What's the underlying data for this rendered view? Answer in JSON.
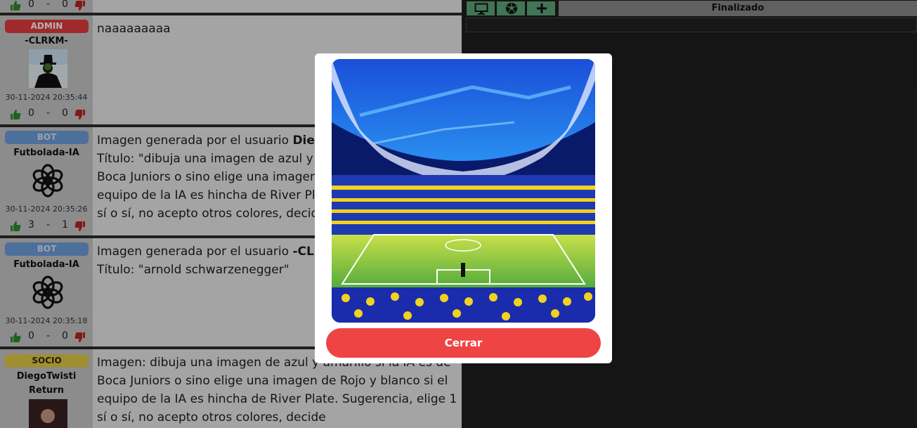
{
  "posts": [
    {
      "votes": {
        "up": "0",
        "sep": "-",
        "down": "0"
      }
    },
    {
      "badge": "ADMIN",
      "username": "-CLRKM-",
      "date": "30-11-2024 20:35:44",
      "votes": {
        "up": "0",
        "sep": "-",
        "down": "0"
      },
      "lines": [
        "naaaaaaaaa"
      ]
    },
    {
      "badge": "BOT",
      "username": "Futbolada-IA",
      "date": "30-11-2024 20:35:26",
      "votes": {
        "up": "3",
        "sep": "-",
        "down": "1"
      },
      "lead": "Imagen generada por el usuario ",
      "lead_bold": "Dieg",
      "lines": [
        "Título: \"dibuja una imagen de azul y",
        "Boca Juniors o sino elige una imagen",
        "equipo de la IA es hincha de River Pl",
        "sí o sí, no acepto otros colores, decid"
      ]
    },
    {
      "badge": "BOT",
      "username": "Futbolada-IA",
      "date": "30-11-2024 20:35:18",
      "votes": {
        "up": "0",
        "sep": "-",
        "down": "0"
      },
      "lead": "Imagen generada por el usuario ",
      "lead_bold": "-CL",
      "lines": [
        "Título: \"arnold schwarzenegger\""
      ]
    },
    {
      "badge": "SOCIO",
      "username_line1": "DiegoTwisti",
      "username_line2": "Return",
      "lines": [
        "Imagen: dibuja una imagen de azul y amarillo si la IA es de",
        "Boca Juniors o sino elige una imagen de Rojo y blanco si el",
        "equipo de la IA es hincha de River Plate. Sugerencia, elige 1",
        "sí o sí, no acepto otros colores, decide"
      ]
    }
  ],
  "toolbar": {
    "icons": [
      "monitor-icon",
      "soccer-ball-icon",
      "plus-icon"
    ],
    "status": "Finalizado"
  },
  "modal": {
    "close_label": "Cerrar"
  },
  "colors": {
    "admin": "#e53c3c",
    "bot": "#6f9fe0",
    "socio": "#e6cc4a",
    "close_button": "#ef4444",
    "toolbar_button": "#5fa87a"
  }
}
